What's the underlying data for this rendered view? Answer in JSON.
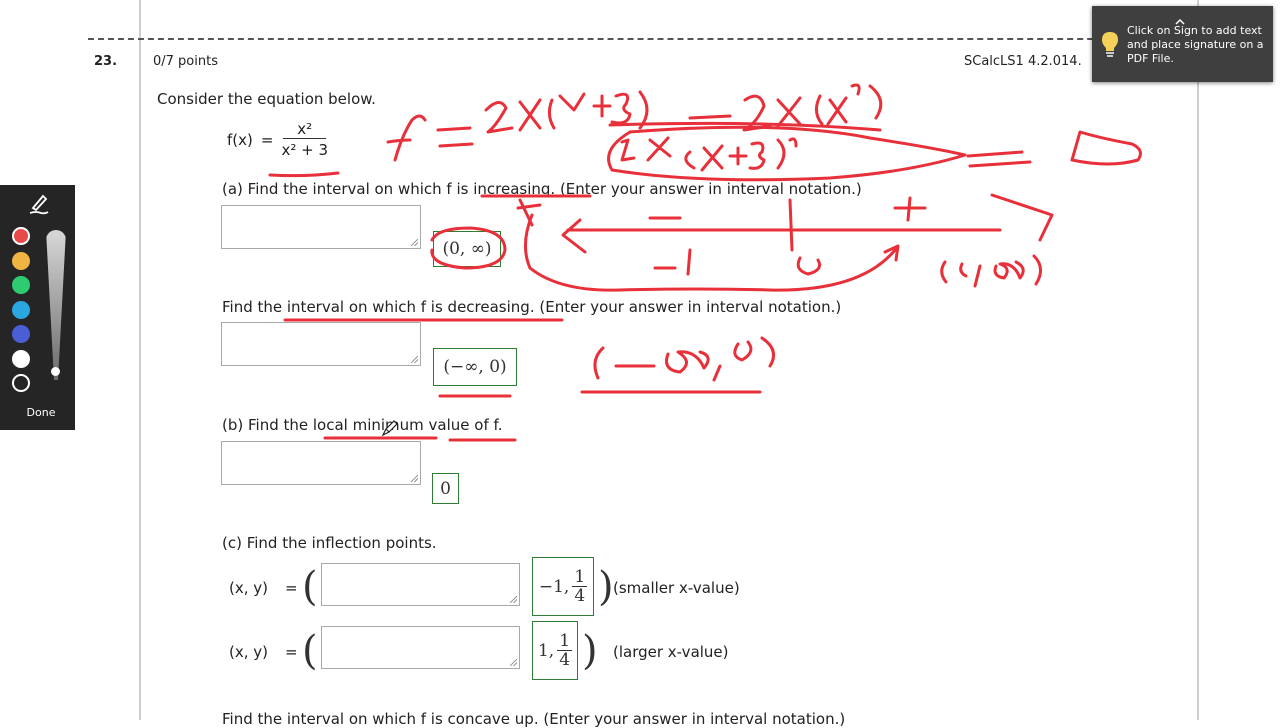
{
  "question": {
    "number": "23.",
    "points": "0/7 points",
    "source": "SCalcLS1 4.2.014.",
    "prompt": "Consider the equation below.",
    "equation": {
      "lhs": "f(x)",
      "eq": "=",
      "numerator": "x²",
      "denominator": "x² + 3"
    }
  },
  "parts": {
    "a_increasing": {
      "text": "(a) Find the interval on which f is increasing. (Enter your answer in interval notation.)",
      "answer": "(0, ∞)"
    },
    "a_decreasing": {
      "text": "Find the interval on which f is decreasing. (Enter your answer in interval notation.)",
      "answer": "(−∞, 0)"
    },
    "b_local_min": {
      "text": "(b) Find the local minimum value of f.",
      "answer": "0"
    },
    "c_inflection": {
      "text": "(c) Find the inflection points.",
      "label": "(x, y)",
      "eq": "=",
      "point1": {
        "x": "−1,",
        "num": "1",
        "den": "4",
        "note": "(smaller x-value)"
      },
      "point2": {
        "x": "1,",
        "num": "1",
        "den": "4",
        "note": "(larger x-value)"
      }
    },
    "concave_up": {
      "text": "Find the interval on which f is concave up. (Enter your answer in interval notation.)"
    }
  },
  "toolbar": {
    "done_label": "Done",
    "colors": [
      "#e84a4a",
      "#f0b442",
      "#2ecc71",
      "#2aa6e0",
      "#4a5fd6",
      "#ffffff",
      "#252525"
    ]
  },
  "tooltip": {
    "text": "Click on Sign to add text and place signature on a PDF File."
  },
  "ink_color": "#e8303a"
}
